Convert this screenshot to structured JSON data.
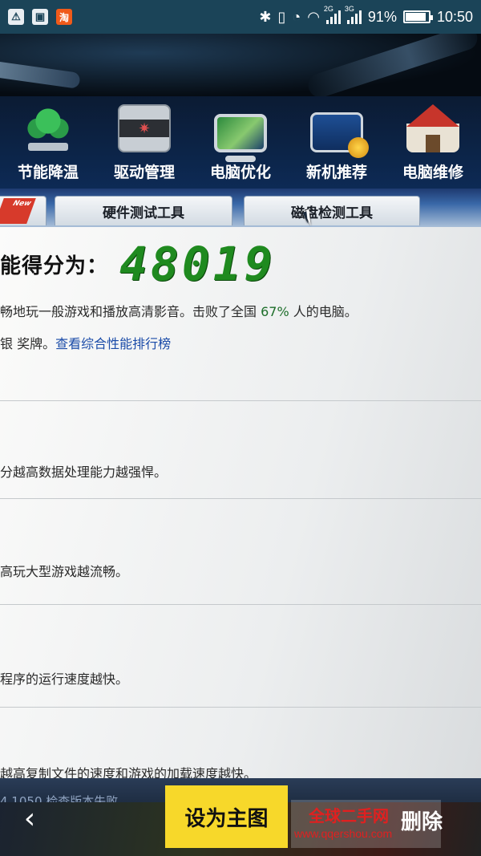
{
  "status_bar": {
    "left_icons": [
      "warning-icon",
      "image-icon",
      "taobao-icon"
    ],
    "taobao_glyph": "淘",
    "net_2g": "2G",
    "net_3g": "3G",
    "battery_percent": "91%",
    "battery_level": 0.91,
    "time": "10:50"
  },
  "nav": {
    "items": [
      {
        "label": "节能降温",
        "icon": "tree-icon"
      },
      {
        "label": "驱动管理",
        "icon": "driver-icon"
      },
      {
        "label": "电脑优化",
        "icon": "monitor-icon"
      },
      {
        "label": "新机推荐",
        "icon": "new-pc-icon"
      },
      {
        "label": "电脑维修",
        "icon": "house-icon"
      }
    ]
  },
  "tabs": {
    "new_badge": "New",
    "items": [
      "硬件测试工具",
      "磁盘检测工具"
    ]
  },
  "score": {
    "label": "能得分为：",
    "value": "48019"
  },
  "summary": {
    "line1_prefix": "畅地玩一般游戏和播放高清影音。击败了全国 ",
    "line1_percent": "67%",
    "line1_suffix": " 人的电脑。",
    "line2_prefix": "银 奖牌。",
    "line2_link": "查看综合性能排行榜"
  },
  "descriptions": [
    "分越高数据处理能力越强悍。",
    "高玩大型游戏越流畅。",
    "程序的运行速度越快。",
    "越高复制文件的速度和游戏的加载速度越快。"
  ],
  "footer": {
    "version": "4.1050    检查版本失败"
  },
  "overlay": {
    "set_main_label": "设为主图",
    "delete_label": "删除",
    "watermark_title": "全球二手网",
    "watermark_url": "www.qqershou.com"
  }
}
